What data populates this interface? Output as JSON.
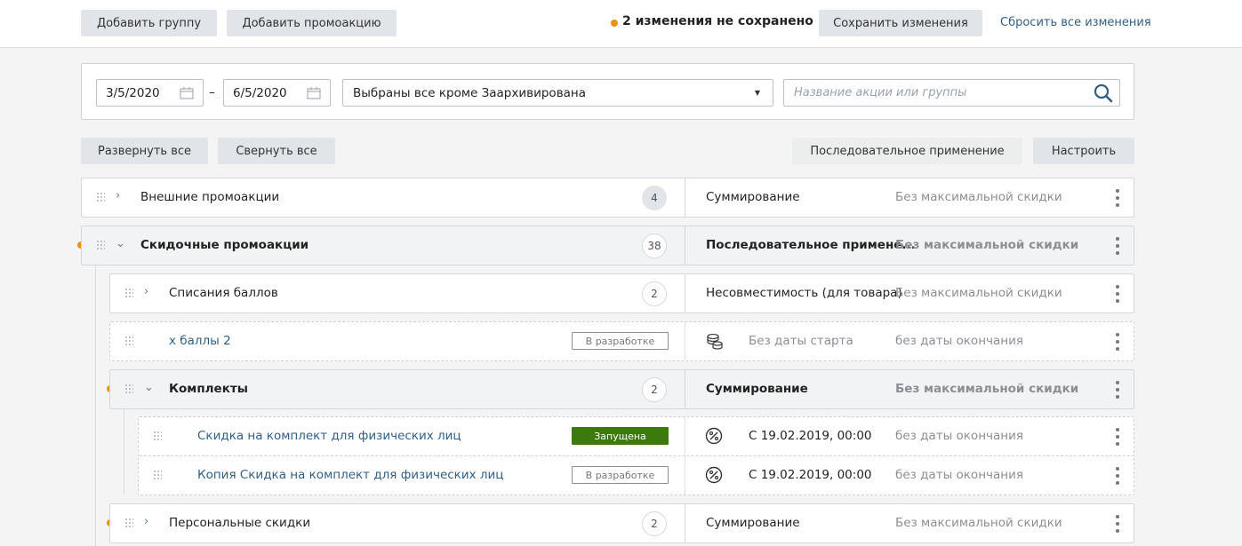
{
  "toolbar": {
    "add_group": "Добавить группу",
    "add_promo": "Добавить промоакцию",
    "unsaved": "2 изменения не сохранено",
    "save": "Сохранить изменения",
    "reset": "Сбросить все изменения"
  },
  "filter": {
    "date_from": "3/5/2020",
    "date_sep": "–",
    "date_to": "6/5/2020",
    "status_select": "Выбраны все кроме Заархивирована",
    "search_placeholder": "Название акции или группы"
  },
  "controls": {
    "expand_all": "Развернуть все",
    "collapse_all": "Свернуть все",
    "sequential": "Последовательное применение",
    "configure": "Настроить"
  },
  "rows": [
    {
      "name": "Внешние промоакции",
      "count": "4",
      "mode": "Суммирование",
      "limit": "Без максимальной скидки"
    },
    {
      "name": "Скидочные промоакции",
      "count": "38",
      "mode": "Последовательное примене...",
      "limit": "Без максимальной скидки"
    },
    {
      "name": "Списания баллов",
      "count": "2",
      "mode": "Несовместимость (для товара)",
      "limit": "Без максимальной скидки"
    },
    {
      "name": "х баллы 2",
      "status": "В разработке",
      "start": "Без даты старта",
      "end": "без даты окончания"
    },
    {
      "name": "Комплекты",
      "count": "2",
      "mode": "Суммирование",
      "limit": "Без максимальной скидки"
    },
    {
      "name": "Скидка на комплект для физических лиц",
      "status": "Запущена",
      "start": "С 19.02.2019, 00:00",
      "end": "без даты окончания"
    },
    {
      "name": "Копия Скидка на комплект для физических лиц",
      "status": "В разработке",
      "start": "С 19.02.2019, 00:00",
      "end": "без даты окончания"
    },
    {
      "name": "Персональные скидки",
      "count": "2",
      "mode": "Суммирование",
      "limit": "Без максимальной скидки"
    }
  ],
  "colors": {
    "accent_dot": "#e89212",
    "running": "#3d7a0e",
    "link": "#2f5f88"
  }
}
